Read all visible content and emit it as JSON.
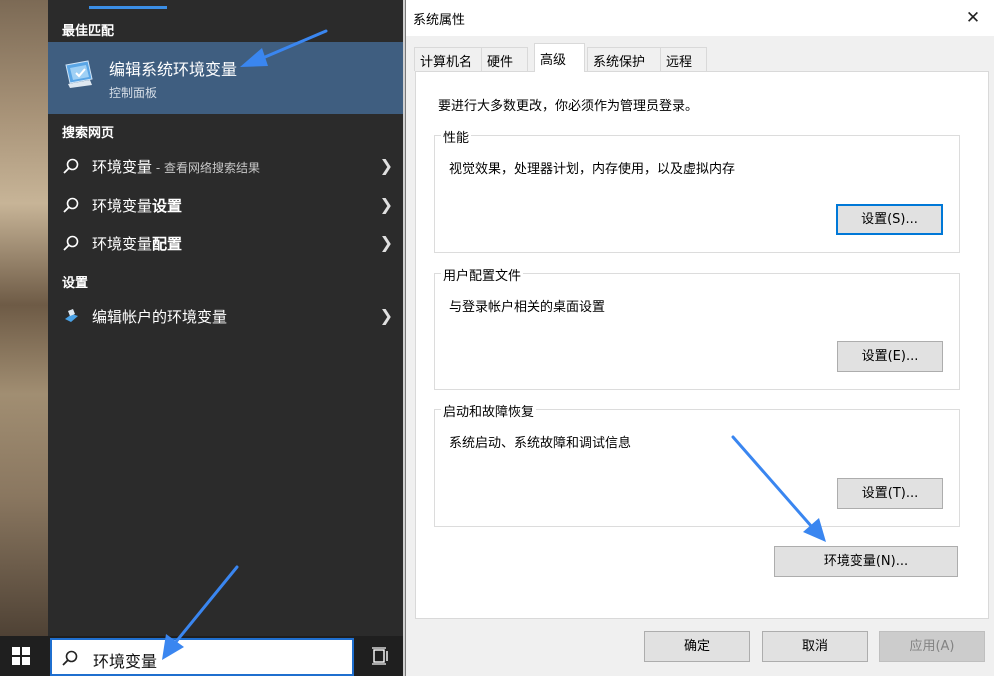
{
  "start_menu": {
    "best_match_header": "最佳匹配",
    "best_match": {
      "title": "编辑系统环境变量",
      "subtitle": "控制面板",
      "icon": "system-properties-icon"
    },
    "web_header": "搜索网页",
    "web_results": [
      {
        "text": "环境变量",
        "suffix": " - 查看网络搜索结果",
        "bold": "",
        "icon": "search-icon"
      },
      {
        "text": "环境变量",
        "suffix": "",
        "bold": "设置",
        "icon": "search-icon"
      },
      {
        "text": "环境变量",
        "suffix": "",
        "bold": "配置",
        "icon": "search-icon"
      }
    ],
    "settings_header": "设置",
    "settings_results": [
      {
        "text": "编辑帐户的环境变量",
        "icon": "settings-user-icon"
      }
    ]
  },
  "taskbar": {
    "search_value": "环境变量",
    "start_icon": "windows-logo-icon",
    "task_view_icon": "task-view-icon"
  },
  "dialog": {
    "title": "系统属性",
    "close_label": "✕",
    "tabs": [
      {
        "label": "计算机名",
        "active": false
      },
      {
        "label": "硬件",
        "active": false
      },
      {
        "label": "高级",
        "active": true
      },
      {
        "label": "系统保护",
        "active": false
      },
      {
        "label": "远程",
        "active": false
      }
    ],
    "admin_note": "要进行大多数更改，你必须作为管理员登录。",
    "groups": [
      {
        "title": "性能",
        "description": "视觉效果，处理器计划，内存使用，以及虚拟内存",
        "button": "设置(S)..."
      },
      {
        "title": "用户配置文件",
        "description": "与登录帐户相关的桌面设置",
        "button": "设置(E)..."
      },
      {
        "title": "启动和故障恢复",
        "description": "系统启动、系统故障和调试信息",
        "button": "设置(T)..."
      }
    ],
    "env_button": "环境变量(N)...",
    "footer": {
      "ok": "确定",
      "cancel": "取消",
      "apply": "应用(A)"
    }
  },
  "colors": {
    "accent": "#3b8ee5",
    "selected_result": "#3f5e80",
    "arrow": "#3a86f0"
  }
}
